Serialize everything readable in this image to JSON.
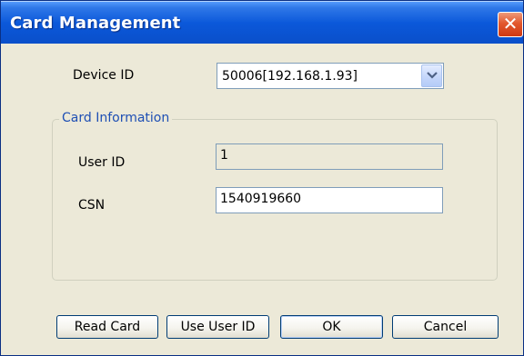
{
  "window": {
    "title": "Card Management",
    "close_symbol": "✕"
  },
  "device": {
    "label": "Device ID",
    "selected": "50006[192.168.1.93]"
  },
  "card_information": {
    "title": "Card Information",
    "user_id_label": "User ID",
    "user_id_value": "1",
    "csn_label": "CSN",
    "csn_value": "1540919660"
  },
  "buttons": {
    "read_card": "Read Card",
    "use_user_id": "Use User ID",
    "ok": "OK",
    "cancel": "Cancel"
  },
  "colors": {
    "title_bar": "#0b58da",
    "dialog_background": "#ece9d8",
    "accent_text": "#1e4fb4",
    "close_button": "#e2582e"
  },
  "icons": {
    "close": "close-icon",
    "dropdown": "chevron-down-icon"
  }
}
